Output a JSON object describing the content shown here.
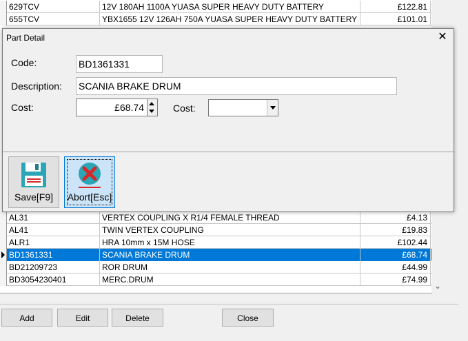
{
  "grid": {
    "top_rows": [
      {
        "code": "629TCV",
        "description": "12V 180AH 1100A YUASA SUPER HEAVY DUTY BATTERY",
        "cost": "£122.81"
      },
      {
        "code": "655TCV",
        "description": "YBX1655 12V 126AH 750A YUASA SUPER HEAVY DUTY BATTERY",
        "cost": "£101.01"
      }
    ],
    "bottom_rows": [
      {
        "code": "AL31",
        "description": "VERTEX COUPLING X R1/4 FEMALE THREAD",
        "cost": "£4.13"
      },
      {
        "code": "AL41",
        "description": "TWIN VERTEX COUPLING",
        "cost": "£19.83"
      },
      {
        "code": "ALR1",
        "description": "HRA 10mm x 15M HOSE",
        "cost": "£102.44"
      },
      {
        "code": "BD1361331",
        "description": "SCANIA BRAKE DRUM",
        "cost": "£68.74",
        "selected": true
      },
      {
        "code": "BD21209723",
        "description": "ROR DRUM",
        "cost": "£44.99"
      },
      {
        "code": "BD3054230401",
        "description": "MERC.DRUM",
        "cost": "£74.99"
      }
    ]
  },
  "buttons": {
    "add": "Add",
    "edit": "Edit",
    "delete": "Delete",
    "close": "Close"
  },
  "dialog": {
    "title": "Part Detail",
    "close_glyph": "✕",
    "code_label": "Code:",
    "code_value": "BD1361331",
    "description_label": "Description:",
    "description_value": "SCANIA BRAKE DRUM",
    "cost_label": "Cost:",
    "cost_value": "£68.74",
    "cost2_label": "Cost:",
    "cost2_value": "",
    "save_label": "Save[F9]",
    "abort_label": "Abort[Esc]"
  },
  "icons": {
    "save": "floppy-disk-icon",
    "abort": "red-x-circle-icon"
  },
  "colors": {
    "selection": "#0078d7",
    "floppy_teal": "#2aa6b6",
    "abort_red": "#d42a2a"
  }
}
